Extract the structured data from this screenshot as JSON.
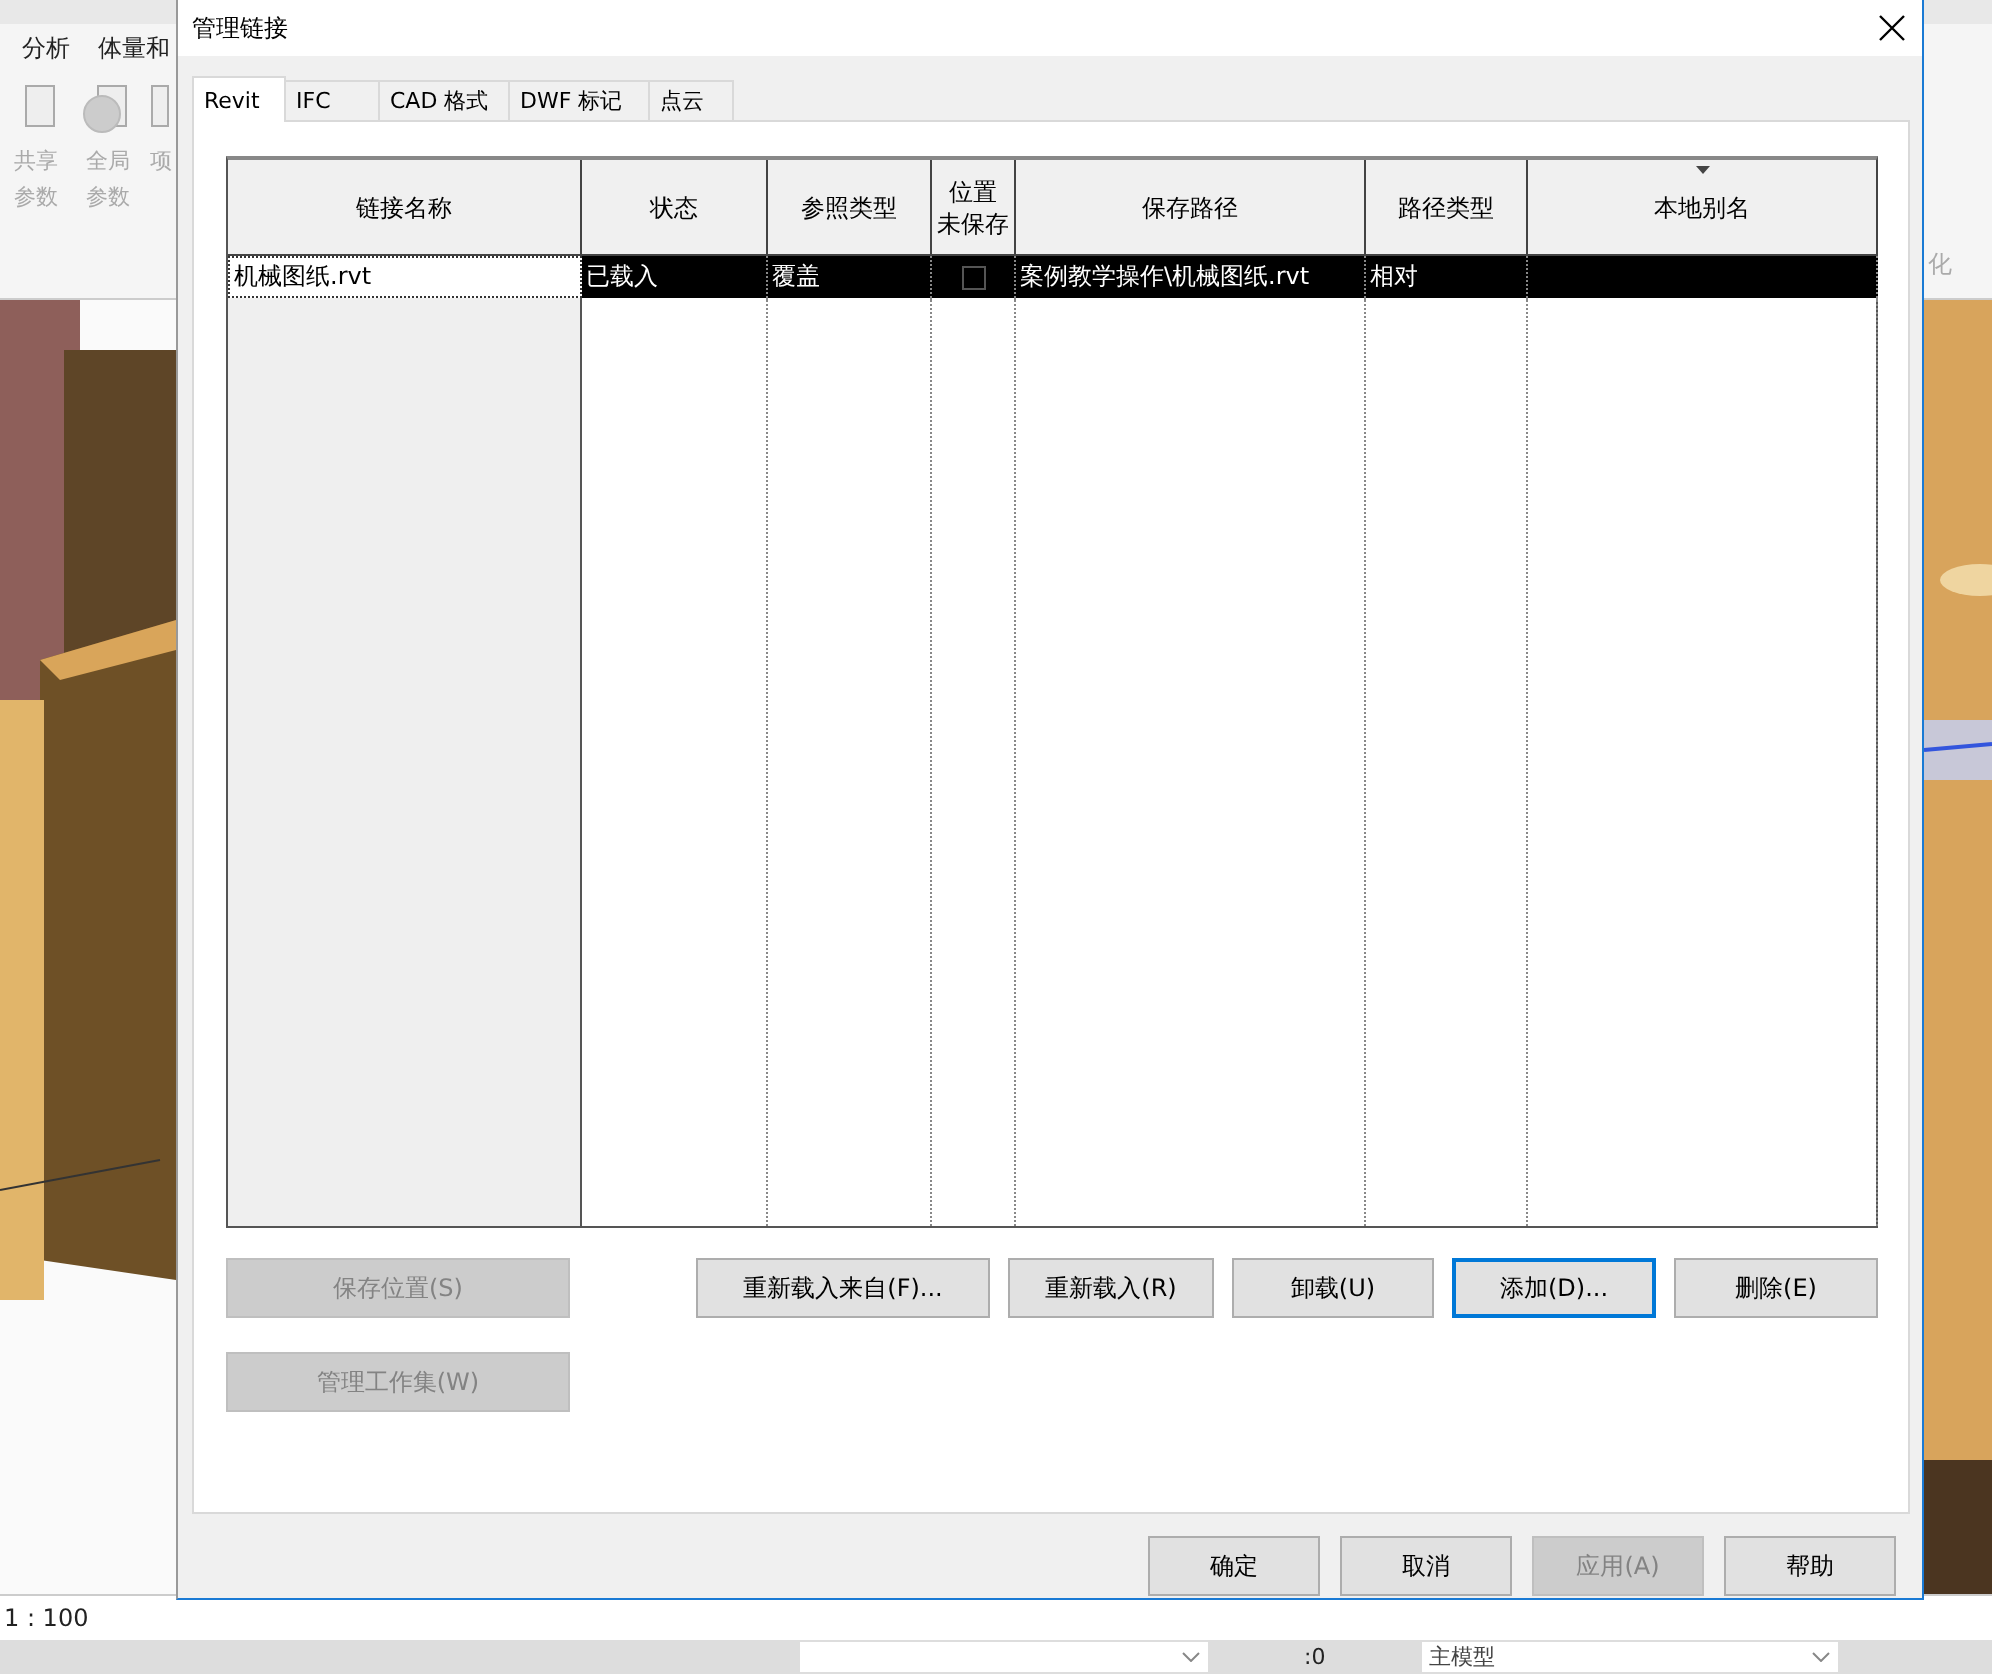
{
  "app": {
    "ribbon_tabs": [
      "分析",
      "体量和"
    ],
    "ribbon_buttons": [
      {
        "label_lines": [
          "共享",
          "参数"
        ]
      },
      {
        "label_lines": [
          "全局",
          "参数"
        ]
      },
      {
        "label_lines": [
          "项"
        ]
      }
    ],
    "ribbon_right_label": "化",
    "view_scale": "1 : 100",
    "bottom_bar": {
      "count": ":0",
      "model": "主模型"
    }
  },
  "dialog": {
    "title": "管理链接",
    "tabs": [
      {
        "label": "Revit",
        "selected": true
      },
      {
        "label": "IFC",
        "selected": false
      },
      {
        "label": "CAD 格式",
        "selected": false
      },
      {
        "label": "DWF 标记",
        "selected": false
      },
      {
        "label": "点云",
        "selected": false
      }
    ],
    "columns": [
      {
        "label": "链接名称",
        "sorted": false
      },
      {
        "label": "状态",
        "sorted": false
      },
      {
        "label": "参照类型",
        "sorted": false
      },
      {
        "label_lines": [
          "位置",
          "未保存"
        ],
        "sorted": false
      },
      {
        "label": "保存路径",
        "sorted": false
      },
      {
        "label": "路径类型",
        "sorted": false
      },
      {
        "label": "本地别名",
        "sorted": true
      }
    ],
    "rows": [
      {
        "name": "机械图纸.rvt",
        "status": "已载入",
        "reference_type": "覆盖",
        "position_unsaved": false,
        "path": "案例教学操作\\机械图纸.rvt",
        "path_type": "相对",
        "selected": true
      }
    ],
    "side_buttons": [
      {
        "label": "保存位置(S)",
        "disabled": true
      },
      {
        "label": "管理工作集(W)",
        "disabled": true
      }
    ],
    "action_buttons": [
      {
        "label": "重新载入来自(F)...",
        "focused": false
      },
      {
        "label": "重新载入(R)",
        "focused": false
      },
      {
        "label": "卸载(U)",
        "focused": false
      },
      {
        "label": "添加(D)...",
        "focused": true
      },
      {
        "label": "删除(E)",
        "focused": false
      }
    ],
    "footer_buttons": [
      {
        "label": "确定",
        "disabled": false
      },
      {
        "label": "取消",
        "disabled": false
      },
      {
        "label": "应用(A)",
        "disabled": true
      },
      {
        "label": "帮助",
        "disabled": false
      }
    ]
  }
}
